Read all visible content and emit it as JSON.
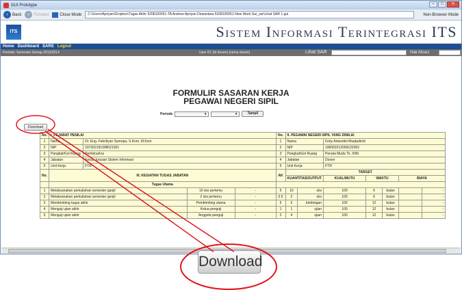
{
  "window": {
    "title": "GUI Prototype"
  },
  "nav": {
    "back": "Back",
    "forward": "Forward",
    "close_mode": "Close Mode",
    "address": "C:\\Users\\Apriyan\\Dropbox\\Tugas Akhir 5208100051-TA Andrew Apriyan Dewantara 5208100051-New Work Gui_sar\\Lihat SAR 1.gui",
    "browser_mode": "Non-Browser Mode"
  },
  "header": {
    "logo": "ITS",
    "system_title": "Sistem Informasi Terintegrasi ITS"
  },
  "menu": [
    "Home",
    "Dashboard",
    "SARS"
  ],
  "menu_logout": "Logout",
  "info": {
    "period": "Periode: Semester Genap 2013/2014",
    "user": "User ID: {id dosen} {nama dosen}",
    "lihat_sar": "Lihat SAR",
    "hak_akses": "Hak Akses"
  },
  "form": {
    "title1": "FORMULIR SASARAN KERJA",
    "title2": "PEGAWAI NEGERI SIPIL",
    "periode_label": "Periode",
    "tampil": "Tampil",
    "download_small": "Download",
    "download_big": "Download"
  },
  "table": {
    "no": "No.",
    "pejabat_header": "I. PEJABAT PENILAI",
    "pns_header": "II. PEGAWAI NEGERI SIPIL YANG DINILAI",
    "fields": [
      {
        "no": "1",
        "label": "Nama",
        "value": "Dr. Eng. Febriliyan Samopa, S.Kom, M.Kom",
        "no2": "1",
        "label2": "Nama",
        "value2": "Feby Artwodini Muqtadiroh"
      },
      {
        "no": "2",
        "label": "NIP",
        "value": "197302191998021001",
        "no2": "2",
        "label2": "NIP",
        "value2": "198302212009122002"
      },
      {
        "no": "3",
        "label": "Pangkat/Gol Ruang",
        "value": "Pembina/Iva",
        "no2": "3",
        "label2": "Pangkat/Gol Ruang",
        "value2": "Penata Muda Tk. I/IIIb"
      },
      {
        "no": "4",
        "label": "Jabatan",
        "value": "Ketua Jurusan Sistem Informasi",
        "no2": "4",
        "label2": "Jabatan",
        "value2": "Dosen"
      },
      {
        "no": "5",
        "label": "Unit Kerja",
        "value": "FTIF",
        "no2": "5",
        "label2": "Unit Kerja",
        "value2": "FTIF"
      }
    ],
    "kegiatan": "III. KEGIATAN TUGAS JABATAN",
    "ak": "AK",
    "target": "TARGET",
    "cols": [
      "KUANTITAS/OUTPUT",
      "KUAL/MUTU",
      "WAKTU",
      "BIAYA"
    ],
    "section": "Tugas Utama",
    "rows": [
      {
        "no": "1",
        "task": "Melaksanakan perkuliahan semester ganjil",
        "jml": "10 sks pertemu",
        "dash": "-",
        "ak": "5",
        "q": "10",
        "unit": "sks",
        "mutu": "100",
        "w": "6",
        "wu": "bulan",
        "b": "-"
      },
      {
        "no": "2",
        "task": "Melaksanakan perkuliahan semester genjil",
        "jml": "2 sks pertemu",
        "dash": "-",
        "ak": "0.5",
        "q": "2",
        "unit": "sks",
        "mutu": "100",
        "w": "6",
        "wu": "bulan",
        "b": "-"
      },
      {
        "no": "3",
        "task": "Membimbing tugas akhir",
        "jml": "Pembimbing utama",
        "dash": "-",
        "ak": "5",
        "q": "5",
        "unit": "bimbingan",
        "mutu": "100",
        "w": "12",
        "wu": "bulan",
        "b": "-"
      },
      {
        "no": "4",
        "task": "Menguji ujian akhir",
        "jml": "Ketua penguji",
        "dash": "-",
        "ak": "1",
        "q": "1",
        "unit": "ujian",
        "mutu": "100",
        "w": "12",
        "wu": "bulan",
        "b": "-"
      },
      {
        "no": "5",
        "task": "Menguji ujian akhir",
        "jml": "Anggota penguji",
        "dash": "-",
        "ak": "2",
        "q": "4",
        "unit": "ujian",
        "mutu": "100",
        "w": "12",
        "wu": "bulan",
        "b": "-"
      }
    ]
  },
  "colors": {
    "menubar": "#1d4d94",
    "annotation": "#e0141c",
    "table_bg": "#fdfbd3"
  }
}
